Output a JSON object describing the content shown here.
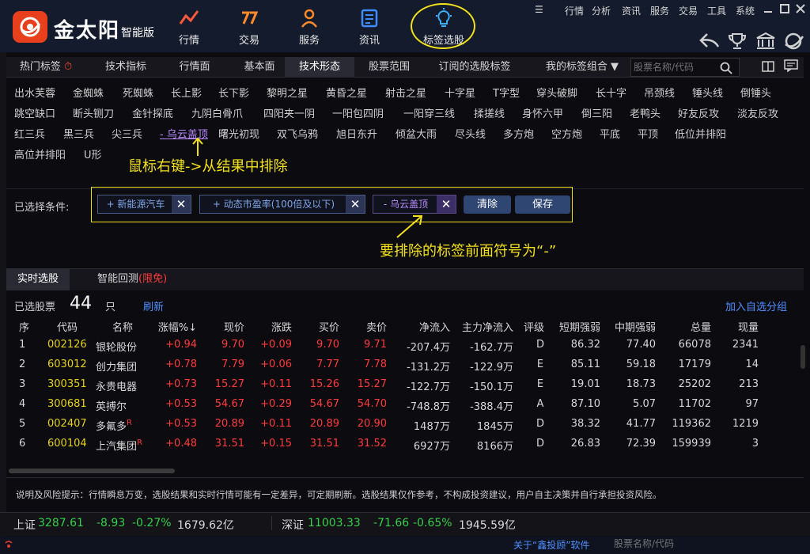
{
  "app": {
    "logo_text": "金太阳",
    "edition": "智能版"
  },
  "nav": [
    {
      "label": "行情",
      "icon": "trend-chart-icon"
    },
    {
      "label": "交易",
      "icon": "trade-icon"
    },
    {
      "label": "服务",
      "icon": "user-icon"
    },
    {
      "label": "资讯",
      "icon": "news-icon"
    },
    {
      "label": "标签选股",
      "icon": "lightbulb-icon"
    }
  ],
  "top_menu": [
    "行情",
    "分析",
    "资讯",
    "服务",
    "交易",
    "工具",
    "系统"
  ],
  "tabs": [
    "热门标签",
    "技术指标",
    "行情面",
    "基本面",
    "技术形态",
    "股票范围",
    "订阅的选股标签",
    "我的标签组合 ▼"
  ],
  "active_tab": "技术形态",
  "search": {
    "placeholder": "股票名称/代码"
  },
  "pattern_tags": {
    "row1": [
      "出水芙蓉",
      "金蜘蛛",
      "死蜘蛛",
      "长上影",
      "长下影",
      "黎明之星",
      "黄昏之星",
      "射击之星",
      "十字星",
      "T字型",
      "穿头破脚",
      "长十字",
      "吊颈线",
      "锤头线",
      "倒锤头"
    ],
    "row2": [
      "跳空缺口",
      "断头铡刀",
      "金针探底",
      "九阴白骨爪",
      "四阳夹一阴",
      "一阳包四阴",
      "一阳穿三线",
      "揉搓线",
      "身怀六甲",
      "倒三阳",
      "老鸭头",
      "好友反攻",
      "淡友反攻"
    ],
    "row3": [
      "红三兵",
      "黑三兵",
      "尖三兵",
      "- 乌云盖顶",
      "曙光初现",
      "双飞乌鸦",
      "旭日东升",
      "倾盆大雨",
      "尽头线",
      "多方炮",
      "空方炮",
      "平底",
      "平顶",
      "低位并排阳"
    ],
    "row4": [
      "高位并排阳",
      "U形"
    ]
  },
  "annotations": {
    "note1": "鼠标右键->从结果中排除",
    "note2": "要排除的标签前面符号为“-”",
    "highlight_color": "#f2e01a"
  },
  "conditions": {
    "label": "已选择条件:",
    "chips": [
      {
        "text": "+ 新能源汽车",
        "type": "include"
      },
      {
        "text": "+ 动态市盈率(100倍及以下)",
        "type": "include"
      },
      {
        "text": "- 乌云盖顶",
        "type": "exclude"
      }
    ],
    "clear_label": "清除",
    "save_label": "保存"
  },
  "result_tabs": {
    "realtime": "实时选股",
    "backtest": "智能回测",
    "backtest_note": "(限免)"
  },
  "summary": {
    "label": "已选股票",
    "count": "44",
    "unit": "只",
    "refresh": "刷新",
    "add_group": "加入自选分组"
  },
  "table": {
    "headers": [
      "序",
      "代码",
      "名称",
      "涨幅%↓",
      "现价",
      "涨跌",
      "买价",
      "卖价",
      "净流入",
      "主力净流入",
      "评级",
      "短期强弱",
      "中期强弱",
      "总量",
      "现量"
    ],
    "rows": [
      {
        "seq": "1",
        "code": "002126",
        "name": "银轮股份",
        "badge": "",
        "pct": "+0.94",
        "price": "9.70",
        "chg": "+0.09",
        "bid": "9.70",
        "ask": "9.71",
        "inflow": "-207.4万",
        "main_inflow": "-162.7万",
        "rating": "D",
        "short": "86.32",
        "mid": "77.40",
        "volume": "66078",
        "cur": "2341"
      },
      {
        "seq": "2",
        "code": "603012",
        "name": "创力集团",
        "badge": "",
        "pct": "+0.78",
        "price": "7.79",
        "chg": "+0.06",
        "bid": "7.77",
        "ask": "7.78",
        "inflow": "-131.2万",
        "main_inflow": "-122.9万",
        "rating": "E",
        "short": "85.11",
        "mid": "59.18",
        "volume": "17179",
        "cur": "14"
      },
      {
        "seq": "3",
        "code": "300351",
        "name": "永贵电器",
        "badge": "",
        "pct": "+0.73",
        "price": "15.27",
        "chg": "+0.11",
        "bid": "15.26",
        "ask": "15.27",
        "inflow": "-122.7万",
        "main_inflow": "-150.1万",
        "rating": "E",
        "short": "19.01",
        "mid": "18.73",
        "volume": "25202",
        "cur": "213"
      },
      {
        "seq": "4",
        "code": "300681",
        "name": "英搏尔",
        "badge": "",
        "pct": "+0.53",
        "price": "54.67",
        "chg": "+0.29",
        "bid": "54.67",
        "ask": "54.70",
        "inflow": "-748.8万",
        "main_inflow": "-388.4万",
        "rating": "A",
        "short": "87.10",
        "mid": "5.07",
        "volume": "11702",
        "cur": "97"
      },
      {
        "seq": "5",
        "code": "002407",
        "name": "多氟多",
        "badge": "R",
        "pct": "+0.53",
        "price": "20.89",
        "chg": "+0.11",
        "bid": "20.89",
        "ask": "20.90",
        "inflow": "1487万",
        "main_inflow": "1845万",
        "rating": "D",
        "short": "38.32",
        "mid": "41.77",
        "volume": "119362",
        "cur": "1219"
      },
      {
        "seq": "6",
        "code": "600104",
        "name": "上汽集团",
        "badge": "R",
        "pct": "+0.48",
        "price": "31.51",
        "chg": "+0.15",
        "bid": "31.51",
        "ask": "31.52",
        "inflow": "6927万",
        "main_inflow": "8166万",
        "rating": "D",
        "short": "26.83",
        "mid": "72.39",
        "volume": "159939",
        "cur": "3"
      }
    ]
  },
  "disclaimer": "说明及风险提示：行情瞬息万变，选股结果和实时行情可能有一定差异，可定期刷新。选股结果仅作参考，不构成投资建议，用户自主决策并自行承担投资风险。",
  "status": {
    "sh_label": "上证",
    "sh_index": "3287.61",
    "sh_chg": "-8.93",
    "sh_pct": "-0.27%",
    "sh_amount": "1679.62亿",
    "sz_label": "深证",
    "sz_index": "11003.33",
    "sz_chg": "-71.66",
    "sz_pct": "-0.65%",
    "sz_amount": "1945.59亿"
  },
  "bottom": {
    "about": "关于“鑫投顾”软件",
    "search_placeholder": "股票名称/代码"
  },
  "colors": {
    "up": "#ff3b3b",
    "down": "#35d04b",
    "code": "#e6d21a",
    "link": "#4f8fff",
    "brand": "#e8401c"
  }
}
